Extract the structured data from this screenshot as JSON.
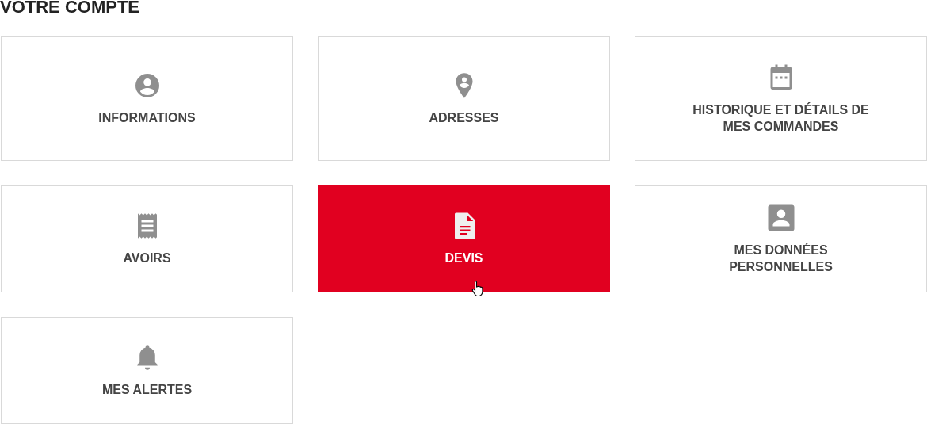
{
  "title": "VOTRE COMPTE",
  "cards": [
    {
      "label": "INFORMATIONS",
      "selected": false
    },
    {
      "label": "ADRESSES",
      "selected": false
    },
    {
      "label": "HISTORIQUE ET DÉTAILS DE MES COMMANDES",
      "selected": false
    },
    {
      "label": "AVOIRS",
      "selected": false
    },
    {
      "label": "DEVIS",
      "selected": true
    },
    {
      "label": "MES DONNÉES PERSONNELLES",
      "selected": false
    },
    {
      "label": "MES ALERTES",
      "selected": false
    }
  ]
}
